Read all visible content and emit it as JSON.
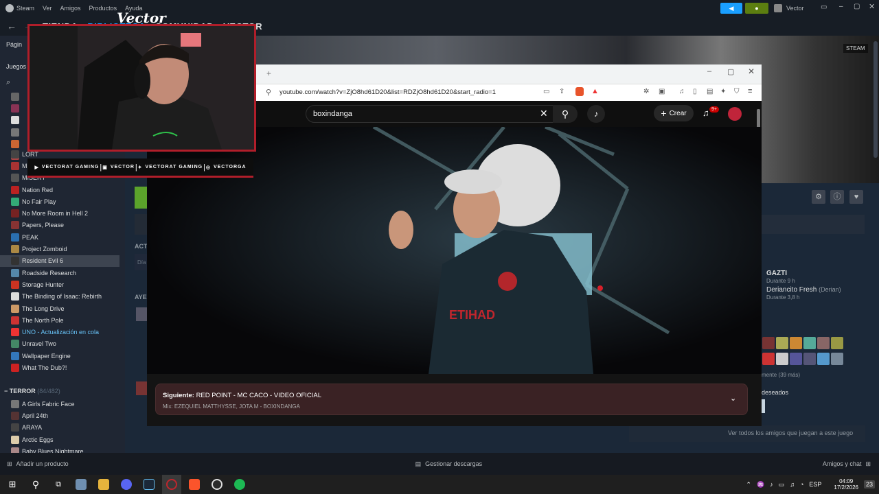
{
  "steam": {
    "menu": [
      "Steam",
      "Ver",
      "Amigos",
      "Productos",
      "Ayuda"
    ],
    "username": "Vector",
    "nav": [
      "TIENDA",
      "BIBLIOTECA",
      "COMUNIDAD",
      "VECTOR"
    ],
    "side_labels": {
      "page": "Págin",
      "games": "Juegos"
    },
    "store_label": "STEAM",
    "games": [
      {
        "name": "LORT",
        "color": "#444"
      },
      {
        "name": "Mimesis",
        "color": "#a33"
      },
      {
        "name": "MISERY",
        "color": "#555"
      },
      {
        "name": "Nation Red",
        "color": "#b22"
      },
      {
        "name": "No Fair Play",
        "color": "#3a7"
      },
      {
        "name": "No More Room in Hell 2",
        "color": "#722"
      },
      {
        "name": "Papers, Please",
        "color": "#833"
      },
      {
        "name": "PEAK",
        "color": "#2a6fb0"
      },
      {
        "name": "Project Zomboid",
        "color": "#a84"
      },
      {
        "name": "Resident Evil 6",
        "color": "#333"
      },
      {
        "name": "Roadside Research",
        "color": "#58a"
      },
      {
        "name": "Storage Hunter",
        "color": "#c32"
      },
      {
        "name": "The Binding of Isaac: Rebirth",
        "color": "#ddd"
      },
      {
        "name": "The Long Drive",
        "color": "#c96"
      },
      {
        "name": "The North Pole",
        "color": "#c33"
      },
      {
        "name": "UNO - Actualización en cola",
        "color": "#e33"
      },
      {
        "name": "Unravel Two",
        "color": "#486"
      },
      {
        "name": "Wallpaper Engine",
        "color": "#37b"
      },
      {
        "name": "What The Dub?!",
        "color": "#c22"
      }
    ],
    "selected_game": "Resident Evil 6",
    "category": {
      "name": "TERROR",
      "count": "(84/482)"
    },
    "terror_games": [
      {
        "name": "A Girls Fabric Face",
        "color": "#777"
      },
      {
        "name": "April 24th",
        "color": "#533"
      },
      {
        "name": "ARAYA",
        "color": "#444"
      },
      {
        "name": "Arctic Eggs",
        "color": "#dca"
      },
      {
        "name": "Baby Blues Nightmare",
        "color": "#a88"
      }
    ],
    "main_labels": {
      "acti": "ACT",
      "dia": "Día",
      "ayer": "AYE"
    },
    "friends": {
      "name": "GAZTI",
      "time1": "Durante 9 h",
      "name2": "Deriancito Fresh",
      "alias2": "(Derian)",
      "time2": "Durante 3,8 h",
      "recent": "mente (39 más)",
      "wishlist": "deseados",
      "all_link": "Ver todos los amigos que juegan a este juego"
    },
    "bottom": {
      "add": "Añadir un producto",
      "downloads": "Gestionar descargas",
      "chat": "Amigos y chat"
    }
  },
  "browser": {
    "url": "youtube.com/watch?v=ZjO8hd61D20&list=RDZjO8hd61D20&start_radio=1",
    "search_value": "boxindanga",
    "create_label": "Crear",
    "notif_badge": "9+",
    "next_label": "Siguiente:",
    "next_title": "RED POINT - MC CACO - VIDEO OFICIAL",
    "mix_line": "Mix: EZEQUIEL MATTHYSSE, JOTA M - BOXINDANGA",
    "shirt_text": "ETIHAD"
  },
  "overlay": {
    "brand": "Vector",
    "links": [
      {
        "icon": "youtube-icon",
        "text": "VECTORAT GAMING"
      },
      {
        "icon": "twitch-icon",
        "text": "VECTOR"
      },
      {
        "icon": "twitter-icon",
        "text": "VECTORAT GAMING"
      },
      {
        "icon": "instagram-icon",
        "text": "VECTORGA"
      }
    ]
  },
  "taskbar": {
    "lang": "ESP",
    "time": "04:09",
    "date": "17/2/2026",
    "notif": "23"
  }
}
